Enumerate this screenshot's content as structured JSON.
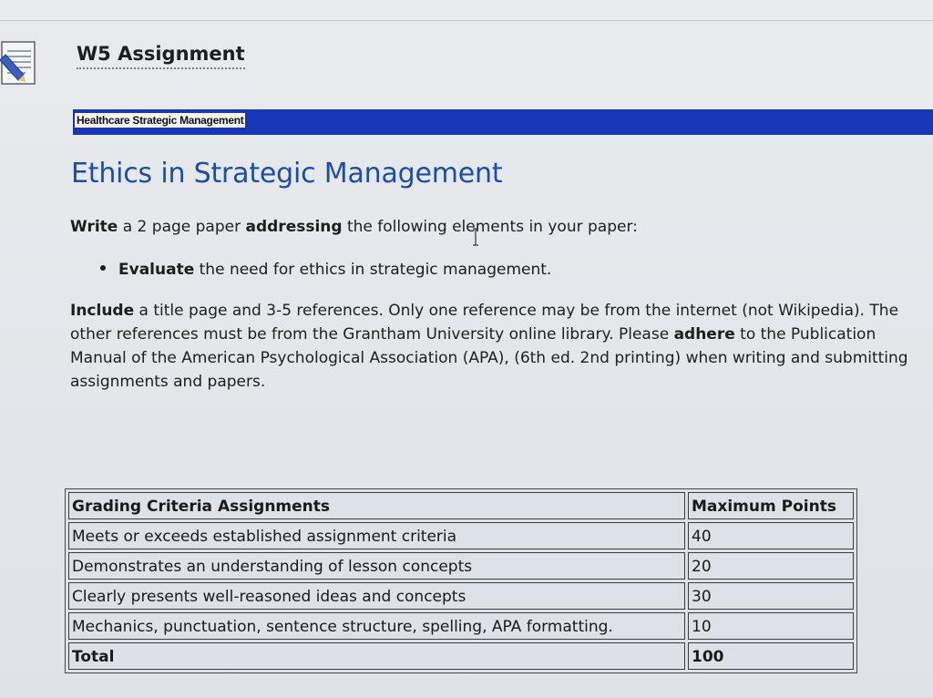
{
  "header": {
    "title": "W5 Assignment",
    "course": "Healthcare Strategic Management"
  },
  "content": {
    "heading": "Ethics in Strategic Management",
    "intro": {
      "w1": "Write",
      "t1": " a 2 page paper ",
      "w2": "addressing",
      "t2": " the following elements in your paper:"
    },
    "bullet": {
      "verb": "Evaluate",
      "rest": " the need for ethics in strategic management."
    },
    "requirements": {
      "w1": "Include",
      "t1": " a title page and 3-5 references. Only one reference may be from the internet (not Wikipedia). The other references must be from the Grantham University online library. Please ",
      "w2": "adhere",
      "t2": " to the Publication Manual of the American Psychological Association (APA), (6th ed. 2nd printing) when writing and submitting assignments and papers."
    }
  },
  "grading_table": {
    "headers": [
      "Grading Criteria Assignments",
      "Maximum Points"
    ],
    "rows": [
      [
        "Meets or exceeds established assignment criteria",
        "40"
      ],
      [
        "Demonstrates an understanding of lesson concepts",
        "20"
      ],
      [
        "Clearly presents well-reasoned ideas and concepts",
        "30"
      ],
      [
        "Mechanics, punctuation, sentence structure, spelling, APA formatting.",
        "10"
      ]
    ],
    "total": [
      "Total",
      "100"
    ]
  },
  "colors": {
    "course_bar": "#1736b8",
    "heading": "#1d4cb0"
  },
  "icons": {
    "assignment": "assignment-document-icon",
    "cursor": "text-cursor-icon"
  }
}
